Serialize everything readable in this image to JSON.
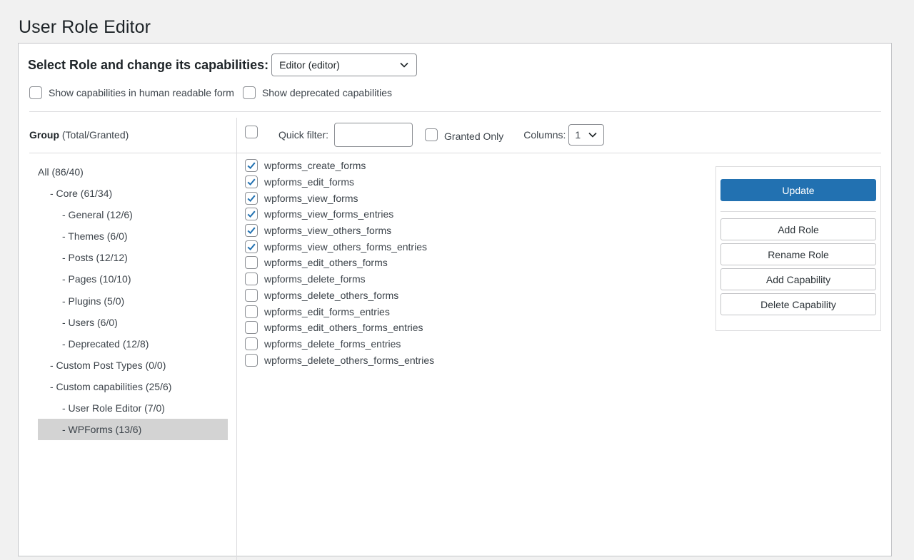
{
  "page": {
    "title": "User Role Editor"
  },
  "role_select": {
    "label": "Select Role and change its capabilities:",
    "selected": "Editor (editor)"
  },
  "options": {
    "human_readable": "Show capabilities in human readable form",
    "deprecated": "Show deprecated capabilities"
  },
  "group_header": {
    "title": "Group",
    "subtitle": "(Total/Granted)"
  },
  "toolbar": {
    "quick_filter_label": "Quick filter:",
    "quick_filter_value": "",
    "granted_only_label": "Granted Only",
    "columns_label": "Columns:",
    "columns_value": "1"
  },
  "groups": [
    {
      "label": "All (86/40)",
      "level": 0
    },
    {
      "label": "- Core (61/34)",
      "level": 1
    },
    {
      "label": "- General (12/6)",
      "level": 2
    },
    {
      "label": "- Themes (6/0)",
      "level": 2
    },
    {
      "label": "- Posts (12/12)",
      "level": 2
    },
    {
      "label": "- Pages (10/10)",
      "level": 2
    },
    {
      "label": "- Plugins (5/0)",
      "level": 2
    },
    {
      "label": "- Users (6/0)",
      "level": 2
    },
    {
      "label": "- Deprecated (12/8)",
      "level": 2
    },
    {
      "label": "- Custom Post Types (0/0)",
      "level": 1
    },
    {
      "label": "- Custom capabilities (25/6)",
      "level": 1
    },
    {
      "label": "- User Role Editor (7/0)",
      "level": 2
    },
    {
      "label": "- WPForms (13/6)",
      "level": 2,
      "selected": true
    }
  ],
  "capabilities": [
    {
      "name": "wpforms_create_forms",
      "checked": true
    },
    {
      "name": "wpforms_edit_forms",
      "checked": true
    },
    {
      "name": "wpforms_view_forms",
      "checked": true
    },
    {
      "name": "wpforms_view_forms_entries",
      "checked": true
    },
    {
      "name": "wpforms_view_others_forms",
      "checked": true
    },
    {
      "name": "wpforms_view_others_forms_entries",
      "checked": true
    },
    {
      "name": "wpforms_edit_others_forms",
      "checked": false
    },
    {
      "name": "wpforms_delete_forms",
      "checked": false
    },
    {
      "name": "wpforms_delete_others_forms",
      "checked": false
    },
    {
      "name": "wpforms_edit_forms_entries",
      "checked": false
    },
    {
      "name": "wpforms_edit_others_forms_entries",
      "checked": false
    },
    {
      "name": "wpforms_delete_forms_entries",
      "checked": false
    },
    {
      "name": "wpforms_delete_others_forms_entries",
      "checked": false
    }
  ],
  "actions": {
    "update": "Update",
    "add_role": "Add Role",
    "rename_role": "Rename Role",
    "add_capability": "Add Capability",
    "delete_capability": "Delete Capability"
  },
  "colors": {
    "primary": "#2271b1",
    "check": "#2271b1",
    "selected_group_bg": "#d3d3d3"
  }
}
